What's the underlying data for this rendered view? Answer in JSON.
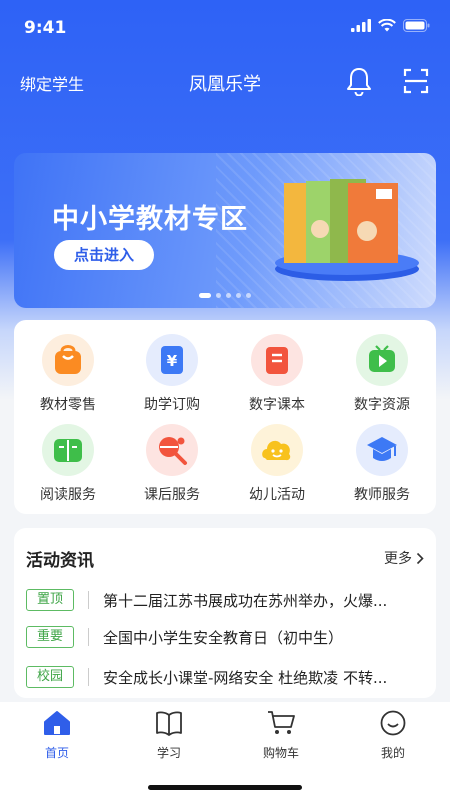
{
  "status": {
    "time": "9:41"
  },
  "navbar": {
    "bind_label": "绑定学生",
    "title": "凤凰乐学"
  },
  "banner": {
    "title": "中小学教材专区",
    "button": "点击进入",
    "slides": 5,
    "active_slide": 1
  },
  "menu": {
    "items": [
      {
        "label": "教材零售",
        "icon": "bag-icon",
        "bg": "#fdeede"
      },
      {
        "label": "助学订购",
        "icon": "yuan-card-icon",
        "bg": "#e5ecfd"
      },
      {
        "label": "数字课本",
        "icon": "book-icon",
        "bg": "#fde4e1"
      },
      {
        "label": "数字资源",
        "icon": "video-icon",
        "bg": "#e3f6e4"
      },
      {
        "label": "阅读服务",
        "icon": "open-book-icon",
        "bg": "#e3f6e4"
      },
      {
        "label": "课后服务",
        "icon": "ping-pong-icon",
        "bg": "#fde4e1"
      },
      {
        "label": "幼儿活动",
        "icon": "smile-cloud-icon",
        "bg": "#fef3d9"
      },
      {
        "label": "教师服务",
        "icon": "graduation-cap-icon",
        "bg": "#e5ecfd"
      }
    ]
  },
  "news": {
    "title": "活动资讯",
    "more": "更多",
    "items": [
      {
        "tag": "置顶",
        "text": "第十二届江苏书展成功在苏州举办，火爆..."
      },
      {
        "tag": "重要",
        "text": "全国中小学生安全教育日（初中生）"
      },
      {
        "tag": "校园",
        "text": "安全成长小课堂-网络安全 杜绝欺凌 不转..."
      }
    ]
  },
  "tabbar": {
    "items": [
      {
        "label": "首页",
        "icon": "home-icon",
        "active": true
      },
      {
        "label": "学习",
        "icon": "book-outline-icon",
        "active": false
      },
      {
        "label": "购物车",
        "icon": "cart-icon",
        "active": false
      },
      {
        "label": "我的",
        "icon": "smile-icon",
        "active": false
      }
    ]
  },
  "colors": {
    "primary": "#2f5ee9",
    "tag_green": "#3fa547"
  }
}
